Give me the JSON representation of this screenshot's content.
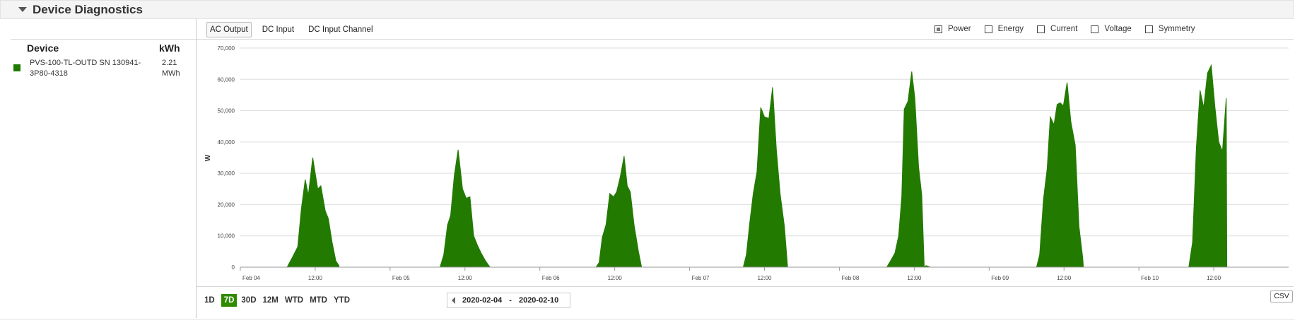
{
  "section": {
    "title": "Device Diagnostics"
  },
  "table": {
    "headers": {
      "device": "Device",
      "kwh": "kWh"
    },
    "rows": [
      {
        "device": "PVS-100-TL-OUTD SN 130941-3P80-4318",
        "kwh": "2.21 MWh",
        "color": "#1f7a00"
      }
    ]
  },
  "tabs": [
    {
      "label": "AC Output",
      "active": true
    },
    {
      "label": "DC Input",
      "active": false
    },
    {
      "label": "DC Input Channel",
      "active": false
    }
  ],
  "toggles": [
    {
      "label": "Power",
      "checked": true
    },
    {
      "label": "Energy",
      "checked": false
    },
    {
      "label": "Current",
      "checked": false
    },
    {
      "label": "Voltage",
      "checked": false
    },
    {
      "label": "Symmetry",
      "checked": false
    }
  ],
  "ranges": [
    {
      "label": "1D",
      "active": false
    },
    {
      "label": "7D",
      "active": true
    },
    {
      "label": "30D",
      "active": false
    },
    {
      "label": "12M",
      "active": false
    },
    {
      "label": "WTD",
      "active": false
    },
    {
      "label": "MTD",
      "active": false
    },
    {
      "label": "YTD",
      "active": false
    }
  ],
  "date_range": {
    "start": "2020-02-04",
    "separator": "-",
    "end": "2020-02-10"
  },
  "csv_label": "CSV",
  "chart_data": {
    "type": "area",
    "ylabel": "W",
    "ylim": [
      0,
      70000
    ],
    "yticks": [
      "0",
      "10,000",
      "20,000",
      "30,000",
      "40,000",
      "50,000",
      "60,000",
      "70,000"
    ],
    "xlim_days": [
      "2020-02-04",
      "2020-02-11"
    ],
    "xticks": [
      {
        "label": "Feb 04",
        "day": 0,
        "hour": 0
      },
      {
        "label": "12:00",
        "day": 0,
        "hour": 12
      },
      {
        "label": "Feb 05",
        "day": 1,
        "hour": 0
      },
      {
        "label": "12:00",
        "day": 1,
        "hour": 12
      },
      {
        "label": "Feb 06",
        "day": 2,
        "hour": 0
      },
      {
        "label": "12:00",
        "day": 2,
        "hour": 12
      },
      {
        "label": "Feb 07",
        "day": 3,
        "hour": 0
      },
      {
        "label": "12:00",
        "day": 3,
        "hour": 12
      },
      {
        "label": "Feb 08",
        "day": 4,
        "hour": 0
      },
      {
        "label": "12:00",
        "day": 4,
        "hour": 12
      },
      {
        "label": "Feb 09",
        "day": 5,
        "hour": 0
      },
      {
        "label": "12:00",
        "day": 5,
        "hour": 12
      },
      {
        "label": "Feb 10",
        "day": 6,
        "hour": 0
      },
      {
        "label": "12:00",
        "day": 6,
        "hour": 12
      }
    ],
    "grid": true,
    "color": "#237a00",
    "days": [
      {
        "date": "2020-02-04",
        "points": [
          [
            7.5,
            0
          ],
          [
            8.3,
            3000
          ],
          [
            9.2,
            6500
          ],
          [
            9.8,
            19000
          ],
          [
            10.4,
            28000
          ],
          [
            10.9,
            23000
          ],
          [
            11.6,
            35000
          ],
          [
            12.4,
            25000
          ],
          [
            12.9,
            26000
          ],
          [
            13.6,
            18000
          ],
          [
            14.1,
            15500
          ],
          [
            14.7,
            8000
          ],
          [
            15.3,
            2000
          ],
          [
            15.8,
            500
          ]
        ]
      },
      {
        "date": "2020-02-05",
        "points": [
          [
            8.0,
            0
          ],
          [
            8.6,
            4000
          ],
          [
            9.2,
            13500
          ],
          [
            9.7,
            16500
          ],
          [
            10.3,
            29500
          ],
          [
            10.9,
            37500
          ],
          [
            11.6,
            25000
          ],
          [
            12.2,
            22000
          ],
          [
            12.8,
            22500
          ],
          [
            13.4,
            10000
          ],
          [
            14.0,
            7000
          ],
          [
            14.6,
            4500
          ],
          [
            15.3,
            2000
          ],
          [
            16.0,
            0
          ]
        ]
      },
      {
        "date": "2020-02-06",
        "points": [
          [
            9.0,
            0
          ],
          [
            9.5,
            1500
          ],
          [
            10.0,
            9500
          ],
          [
            10.6,
            13500
          ],
          [
            11.2,
            23500
          ],
          [
            11.8,
            22500
          ],
          [
            12.3,
            24000
          ],
          [
            12.9,
            29000
          ],
          [
            13.5,
            35500
          ],
          [
            14.0,
            26000
          ],
          [
            14.5,
            24000
          ],
          [
            15.1,
            13500
          ],
          [
            15.8,
            5000
          ],
          [
            16.3,
            0
          ]
        ]
      },
      {
        "date": "2020-02-07",
        "points": [
          [
            8.6,
            0
          ],
          [
            9.1,
            4000
          ],
          [
            9.6,
            13500
          ],
          [
            10.2,
            23500
          ],
          [
            10.8,
            30500
          ],
          [
            11.4,
            51000
          ],
          [
            12.0,
            48000
          ],
          [
            12.7,
            47500
          ],
          [
            13.3,
            57500
          ],
          [
            13.9,
            37500
          ],
          [
            14.5,
            23500
          ],
          [
            15.2,
            13000
          ],
          [
            15.7,
            0
          ]
        ]
      },
      {
        "date": "2020-02-08",
        "points": [
          [
            7.6,
            0
          ],
          [
            8.2,
            2000
          ],
          [
            8.9,
            4500
          ],
          [
            9.5,
            10000
          ],
          [
            10.0,
            22500
          ],
          [
            10.4,
            50500
          ],
          [
            11.0,
            53000
          ],
          [
            11.6,
            62500
          ],
          [
            12.1,
            54000
          ],
          [
            12.7,
            32000
          ],
          [
            13.2,
            23000
          ],
          [
            13.6,
            0
          ],
          [
            13.9,
            500
          ],
          [
            14.6,
            0
          ]
        ]
      },
      {
        "date": "2020-02-09",
        "points": [
          [
            7.6,
            0
          ],
          [
            8.1,
            4000
          ],
          [
            8.7,
            21500
          ],
          [
            9.3,
            31500
          ],
          [
            9.8,
            48000
          ],
          [
            10.4,
            45500
          ],
          [
            10.9,
            52000
          ],
          [
            11.4,
            52500
          ],
          [
            11.9,
            51500
          ],
          [
            12.5,
            59000
          ],
          [
            13.1,
            46500
          ],
          [
            13.8,
            39000
          ],
          [
            14.4,
            13000
          ],
          [
            15.0,
            3000
          ],
          [
            15.1,
            0
          ]
        ]
      },
      {
        "date": "2020-02-10",
        "points": [
          [
            8.0,
            0
          ],
          [
            8.6,
            8000
          ],
          [
            9.2,
            38000
          ],
          [
            9.8,
            56500
          ],
          [
            10.4,
            51000
          ],
          [
            11.0,
            62000
          ],
          [
            11.6,
            64500
          ],
          [
            12.2,
            51000
          ],
          [
            12.8,
            40000
          ],
          [
            13.4,
            37000
          ],
          [
            14.0,
            54000
          ],
          [
            14.1,
            0
          ]
        ]
      }
    ]
  }
}
